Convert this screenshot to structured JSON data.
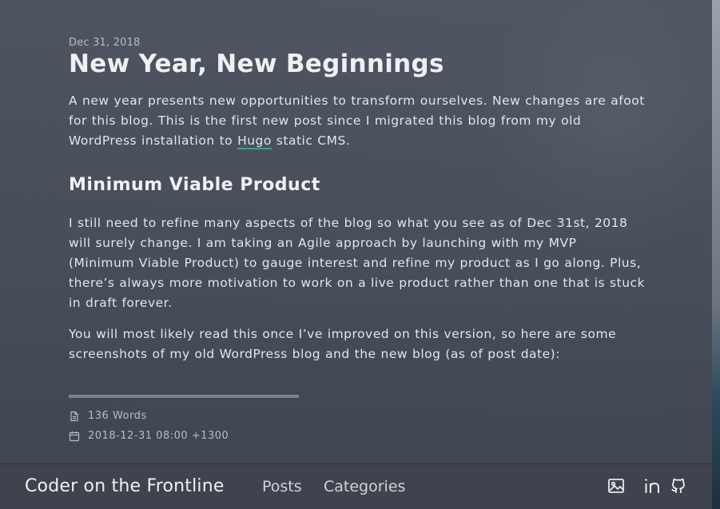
{
  "article": {
    "date": "Dec 31, 2018",
    "title": "New Year, New Beginnings",
    "intro": {
      "before_link": "A new year presents new opportunities to transform ourselves. New changes are afoot for this blog. This is the first new post since I migrated this blog from my old WordPress installation to ",
      "link_text": "Hugo",
      "after_link": " static CMS."
    },
    "section_heading": "Minimum Viable Product",
    "paragraph_2": "I still need to refine many aspects of the blog so what you see as of Dec 31st, 2018 will surely change. I am taking an Agile approach by launching with my MVP (Minimum Viable Product) to gauge interest and refine my product as I go along. Plus, there’s always more motivation to work on a live product rather than one that is stuck in draft forever.",
    "paragraph_3": "You will most likely read this once I’ve improved on this version, so here are some screenshots of my old WordPress blog and the new blog (as of post date):"
  },
  "meta": {
    "word_count": "136 Words",
    "timestamp": "2018-12-31 08:00 +1300",
    "words_icon": "document-icon",
    "date_icon": "calendar-icon"
  },
  "navbar": {
    "brand": "Coder on the Frontline",
    "links": [
      {
        "label": "Posts"
      },
      {
        "label": "Categories"
      }
    ],
    "icons": [
      "image-icon",
      "linkedin-icon",
      "github-icon"
    ]
  },
  "colors": {
    "link_underline": "#2fa886",
    "navbar_bg": "#3e434d",
    "page_bg": "#4b515d"
  }
}
